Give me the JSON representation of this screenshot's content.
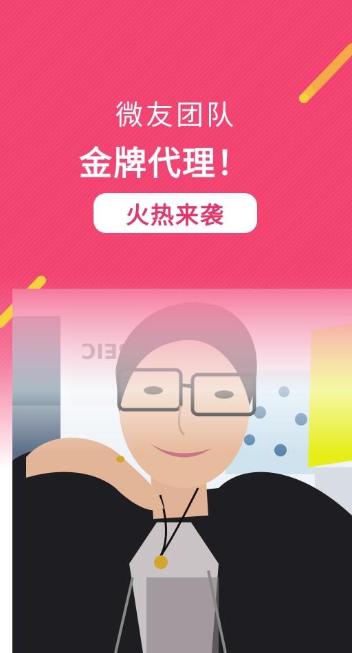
{
  "headline": {
    "line1": "微友团队",
    "line2": "金牌代理！"
  },
  "badge": {
    "label": "火热来袭"
  },
  "photo": {
    "background_sign_text": "SELECTED",
    "subject": "woman-with-glasses-selfie"
  },
  "colors": {
    "background": "#f2406f",
    "accent_yellow": "#f5d13a",
    "badge_text": "#e83568"
  }
}
